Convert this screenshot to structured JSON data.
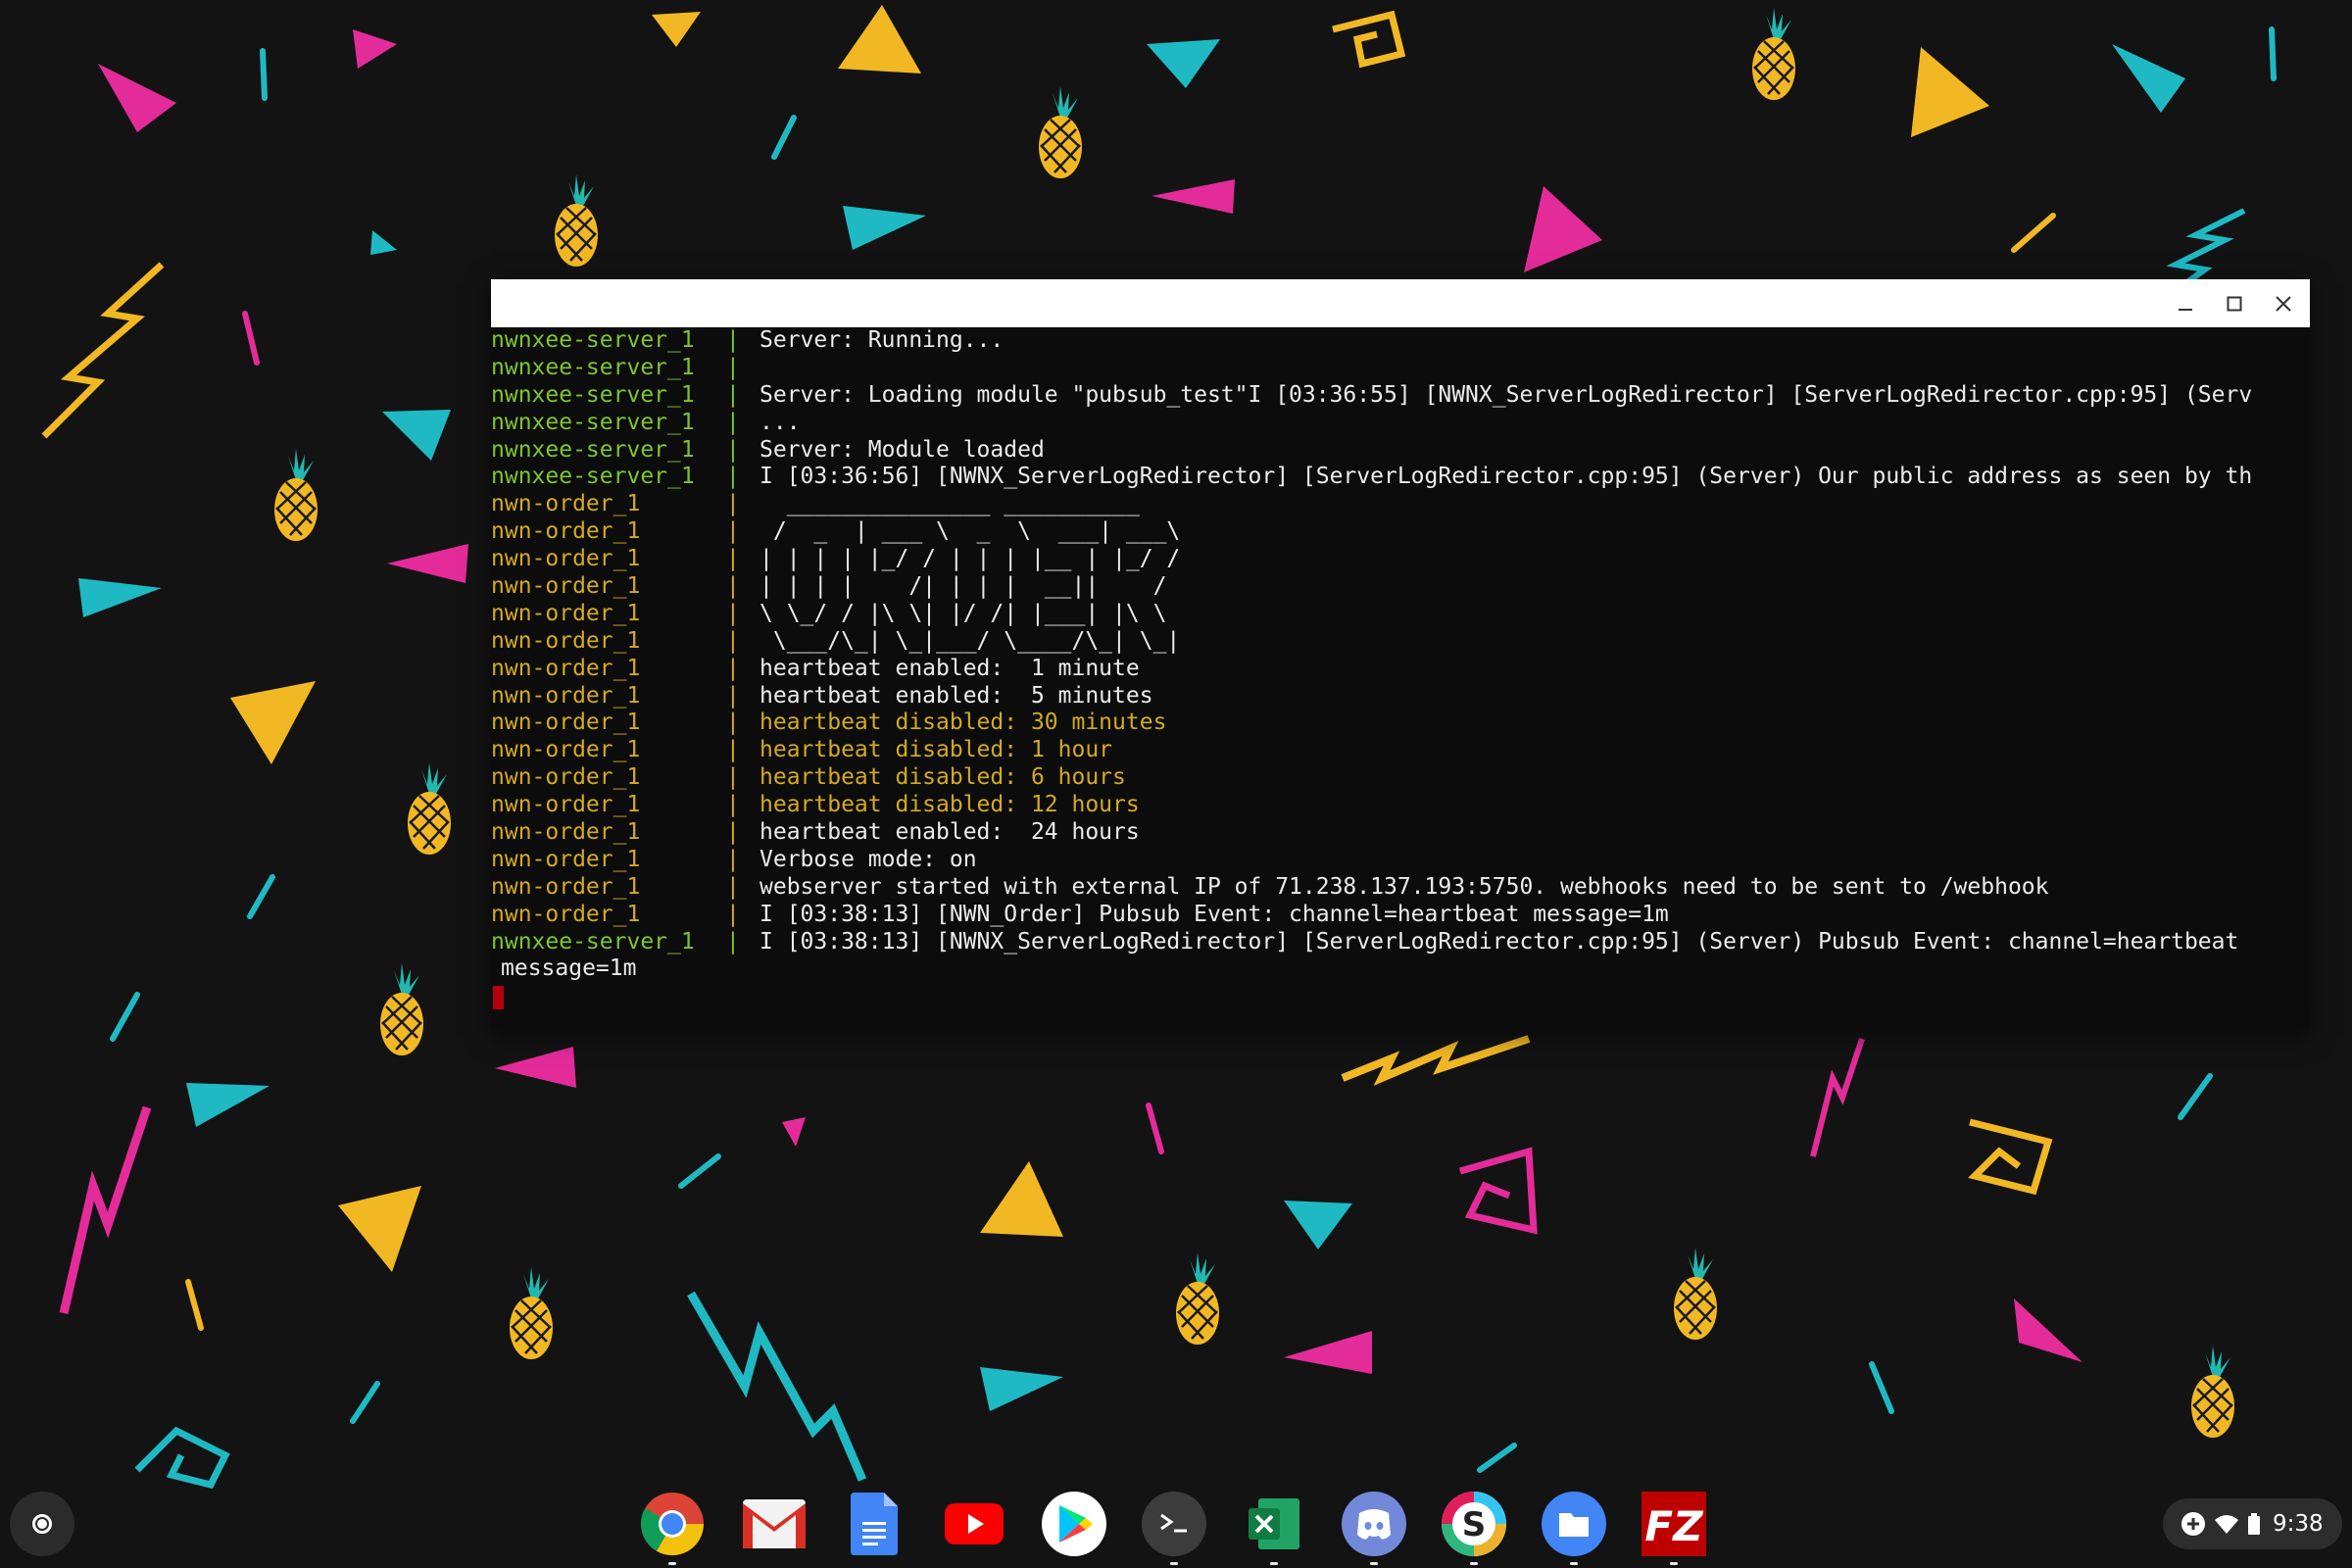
{
  "window": {
    "controls": {
      "minimize_icon": "minimize-icon",
      "maximize_icon": "maximize-icon",
      "close_icon": "close-icon"
    }
  },
  "terminal": {
    "separator": "|",
    "lines": [
      {
        "service": "nwnxee-server_1",
        "kind": "server",
        "text": "Server: Running...",
        "style": "normal"
      },
      {
        "service": "nwnxee-server_1",
        "kind": "server",
        "text": "",
        "style": "normal"
      },
      {
        "service": "nwnxee-server_1",
        "kind": "server",
        "text": "Server: Loading module \"pubsub_test\"I [03:36:55] [NWNX_ServerLogRedirector] [ServerLogRedirector.cpp:95] (Serv",
        "style": "normal"
      },
      {
        "service": "nwnxee-server_1",
        "kind": "server",
        "text": "...",
        "style": "normal"
      },
      {
        "service": "nwnxee-server_1",
        "kind": "server",
        "text": "Server: Module loaded",
        "style": "normal"
      },
      {
        "service": "nwnxee-server_1",
        "kind": "server",
        "text": "I [03:36:56] [NWNX_ServerLogRedirector] [ServerLogRedirector.cpp:95] (Server) Our public address as seen by th",
        "style": "normal"
      },
      {
        "service": "nwn-order_1",
        "kind": "order",
        "text": "  _______________ __________",
        "style": "normal"
      },
      {
        "service": "nwn-order_1",
        "kind": "order",
        "text": " /  _  | ___ \\  _  \\  ___| ___\\",
        "style": "normal"
      },
      {
        "service": "nwn-order_1",
        "kind": "order",
        "text": "| | | | |_/ / | | | |__ | |_/ /",
        "style": "normal"
      },
      {
        "service": "nwn-order_1",
        "kind": "order",
        "text": "| | | |    /| | | |  __||    /",
        "style": "normal"
      },
      {
        "service": "nwn-order_1",
        "kind": "order",
        "text": "\\ \\_/ / |\\ \\| |/ /| |___| |\\ \\",
        "style": "normal"
      },
      {
        "service": "nwn-order_1",
        "kind": "order",
        "text": " \\___/\\_| \\_|___/ \\____/\\_| \\_|",
        "style": "normal"
      },
      {
        "service": "nwn-order_1",
        "kind": "order",
        "text": "heartbeat enabled:  1 minute",
        "style": "normal"
      },
      {
        "service": "nwn-order_1",
        "kind": "order",
        "text": "heartbeat enabled:  5 minutes",
        "style": "normal"
      },
      {
        "service": "nwn-order_1",
        "kind": "order",
        "text": "heartbeat disabled: 30 minutes",
        "style": "warn"
      },
      {
        "service": "nwn-order_1",
        "kind": "order",
        "text": "heartbeat disabled: 1 hour",
        "style": "warn"
      },
      {
        "service": "nwn-order_1",
        "kind": "order",
        "text": "heartbeat disabled: 6 hours",
        "style": "warn"
      },
      {
        "service": "nwn-order_1",
        "kind": "order",
        "text": "heartbeat disabled: 12 hours",
        "style": "warn"
      },
      {
        "service": "nwn-order_1",
        "kind": "order",
        "text": "heartbeat enabled:  24 hours",
        "style": "normal"
      },
      {
        "service": "nwn-order_1",
        "kind": "order",
        "text": "Verbose mode: on",
        "style": "normal"
      },
      {
        "service": "nwn-order_1",
        "kind": "order",
        "text": "webserver started with external IP of 71.238.137.193:5750. webhooks need to be sent to /webhook",
        "style": "normal"
      },
      {
        "service": "nwn-order_1",
        "kind": "order",
        "text": "I [03:38:13] [NWN_Order] Pubsub Event: channel=heartbeat message=1m",
        "style": "normal"
      },
      {
        "service": "nwnxee-server_1",
        "kind": "server",
        "text": "I [03:38:13] [NWNX_ServerLogRedirector] [ServerLogRedirector.cpp:95] (Server) Pubsub Event: channel=heartbeat",
        "style": "normal"
      }
    ],
    "continuation": "message=1m"
  },
  "shelf": {
    "launcher_icon": "launcher-icon",
    "apps": [
      {
        "name": "chrome-icon",
        "running": true
      },
      {
        "name": "gmail-icon",
        "running": false
      },
      {
        "name": "google-docs-icon",
        "running": false
      },
      {
        "name": "youtube-icon",
        "running": false
      },
      {
        "name": "play-store-icon",
        "running": false
      },
      {
        "name": "terminal-icon",
        "running": true
      },
      {
        "name": "excel-icon",
        "running": true
      },
      {
        "name": "discord-icon",
        "running": true
      },
      {
        "name": "slack-icon",
        "running": true
      },
      {
        "name": "files-icon",
        "running": true
      },
      {
        "name": "filezilla-icon",
        "running": true
      }
    ],
    "tray": {
      "time": "9:38",
      "icons": [
        "add-circle-icon",
        "wifi-icon",
        "battery-icon"
      ]
    }
  },
  "colors": {
    "server_prefix": "#7ec52f",
    "order_prefix": "#d4aa1f",
    "terminal_text": "#ececec",
    "cursor": "#b3000f",
    "wallpaper_pink": "#e42b9a",
    "wallpaper_yellow": "#f2b824",
    "wallpaper_teal": "#1fb9c4"
  }
}
